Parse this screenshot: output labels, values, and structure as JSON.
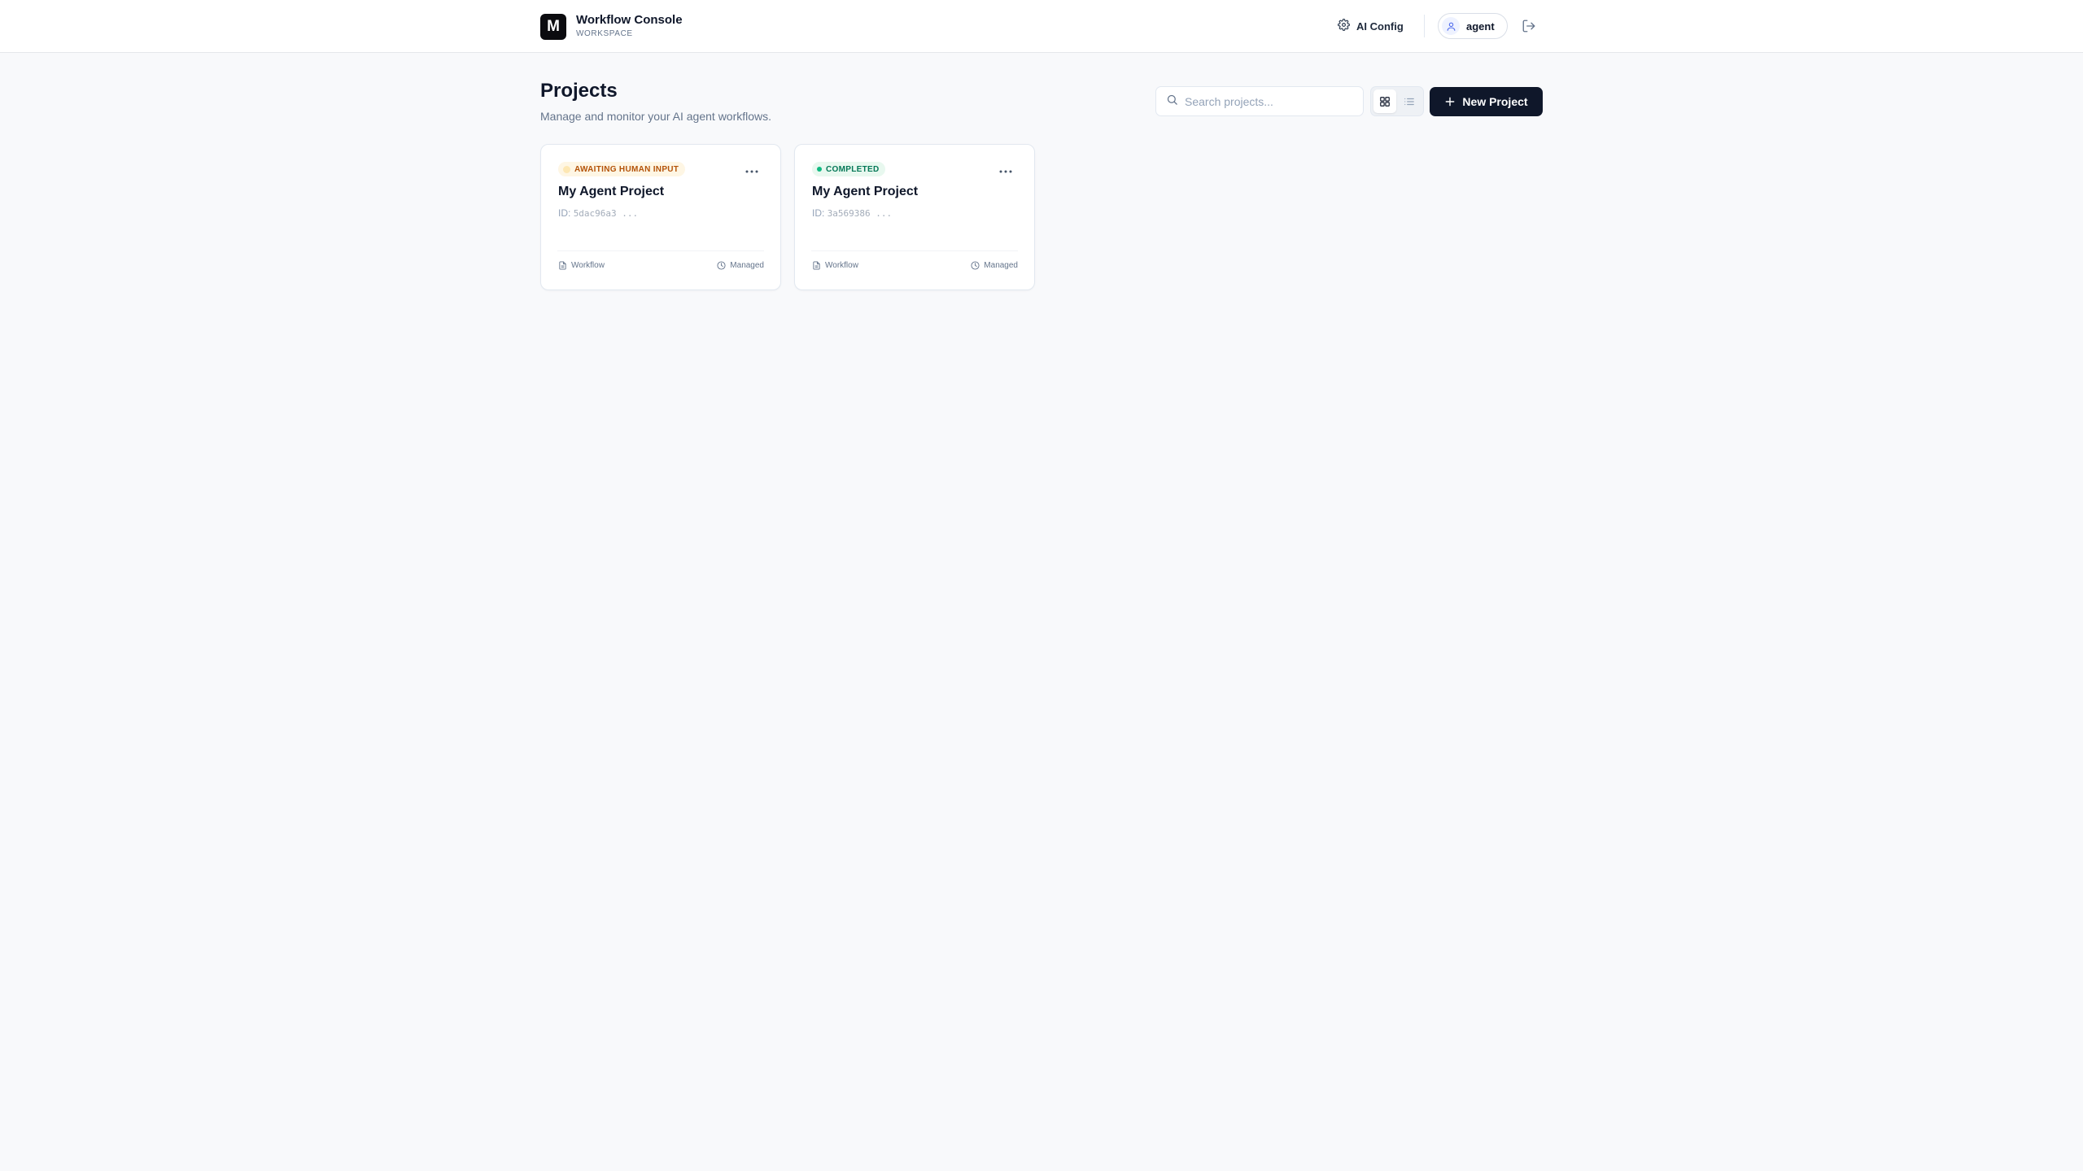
{
  "app": {
    "title": "Workflow Console",
    "subtitle": "WORKSPACE",
    "logo_letter": "M"
  },
  "nav": {
    "ai_config_label": "AI Config",
    "user_name": "agent"
  },
  "page": {
    "title": "Projects",
    "subtitle": "Manage and monitor your AI agent workflows."
  },
  "search": {
    "placeholder": "Search projects...",
    "value": ""
  },
  "view_toggle": {
    "active": "grid"
  },
  "new_project_label": "New Project",
  "projects": [
    {
      "status": "AWAITING HUMAN INPUT",
      "status_color": "#b45309",
      "name": "My Agent Project",
      "id_label": "ID:",
      "id_value": "5dac96a3 ...",
      "type_label": "Workflow",
      "mode_label": "Managed"
    },
    {
      "status": "COMPLETED",
      "status_color": "#047857",
      "name": "My Agent Project",
      "id_label": "ID:",
      "id_value": "3a569386 ...",
      "type_label": "Workflow",
      "mode_label": "Managed"
    }
  ],
  "colors": {
    "primary": "#0f172a",
    "background": "#f8f9fb",
    "awaiting_bg": "#fef6e4",
    "completed_bg": "#e8f8ef",
    "completed_dot": "#10b981"
  },
  "icons": {
    "ai_config": "gear-icon",
    "user": "user-icon",
    "logout": "logout-icon",
    "search": "search-icon",
    "grid_view": "grid-icon",
    "list_view": "list-icon",
    "new_project": "plus-icon",
    "card_menu": "more-horizontal-icon",
    "workflow": "file-icon",
    "managed": "clock-icon"
  }
}
